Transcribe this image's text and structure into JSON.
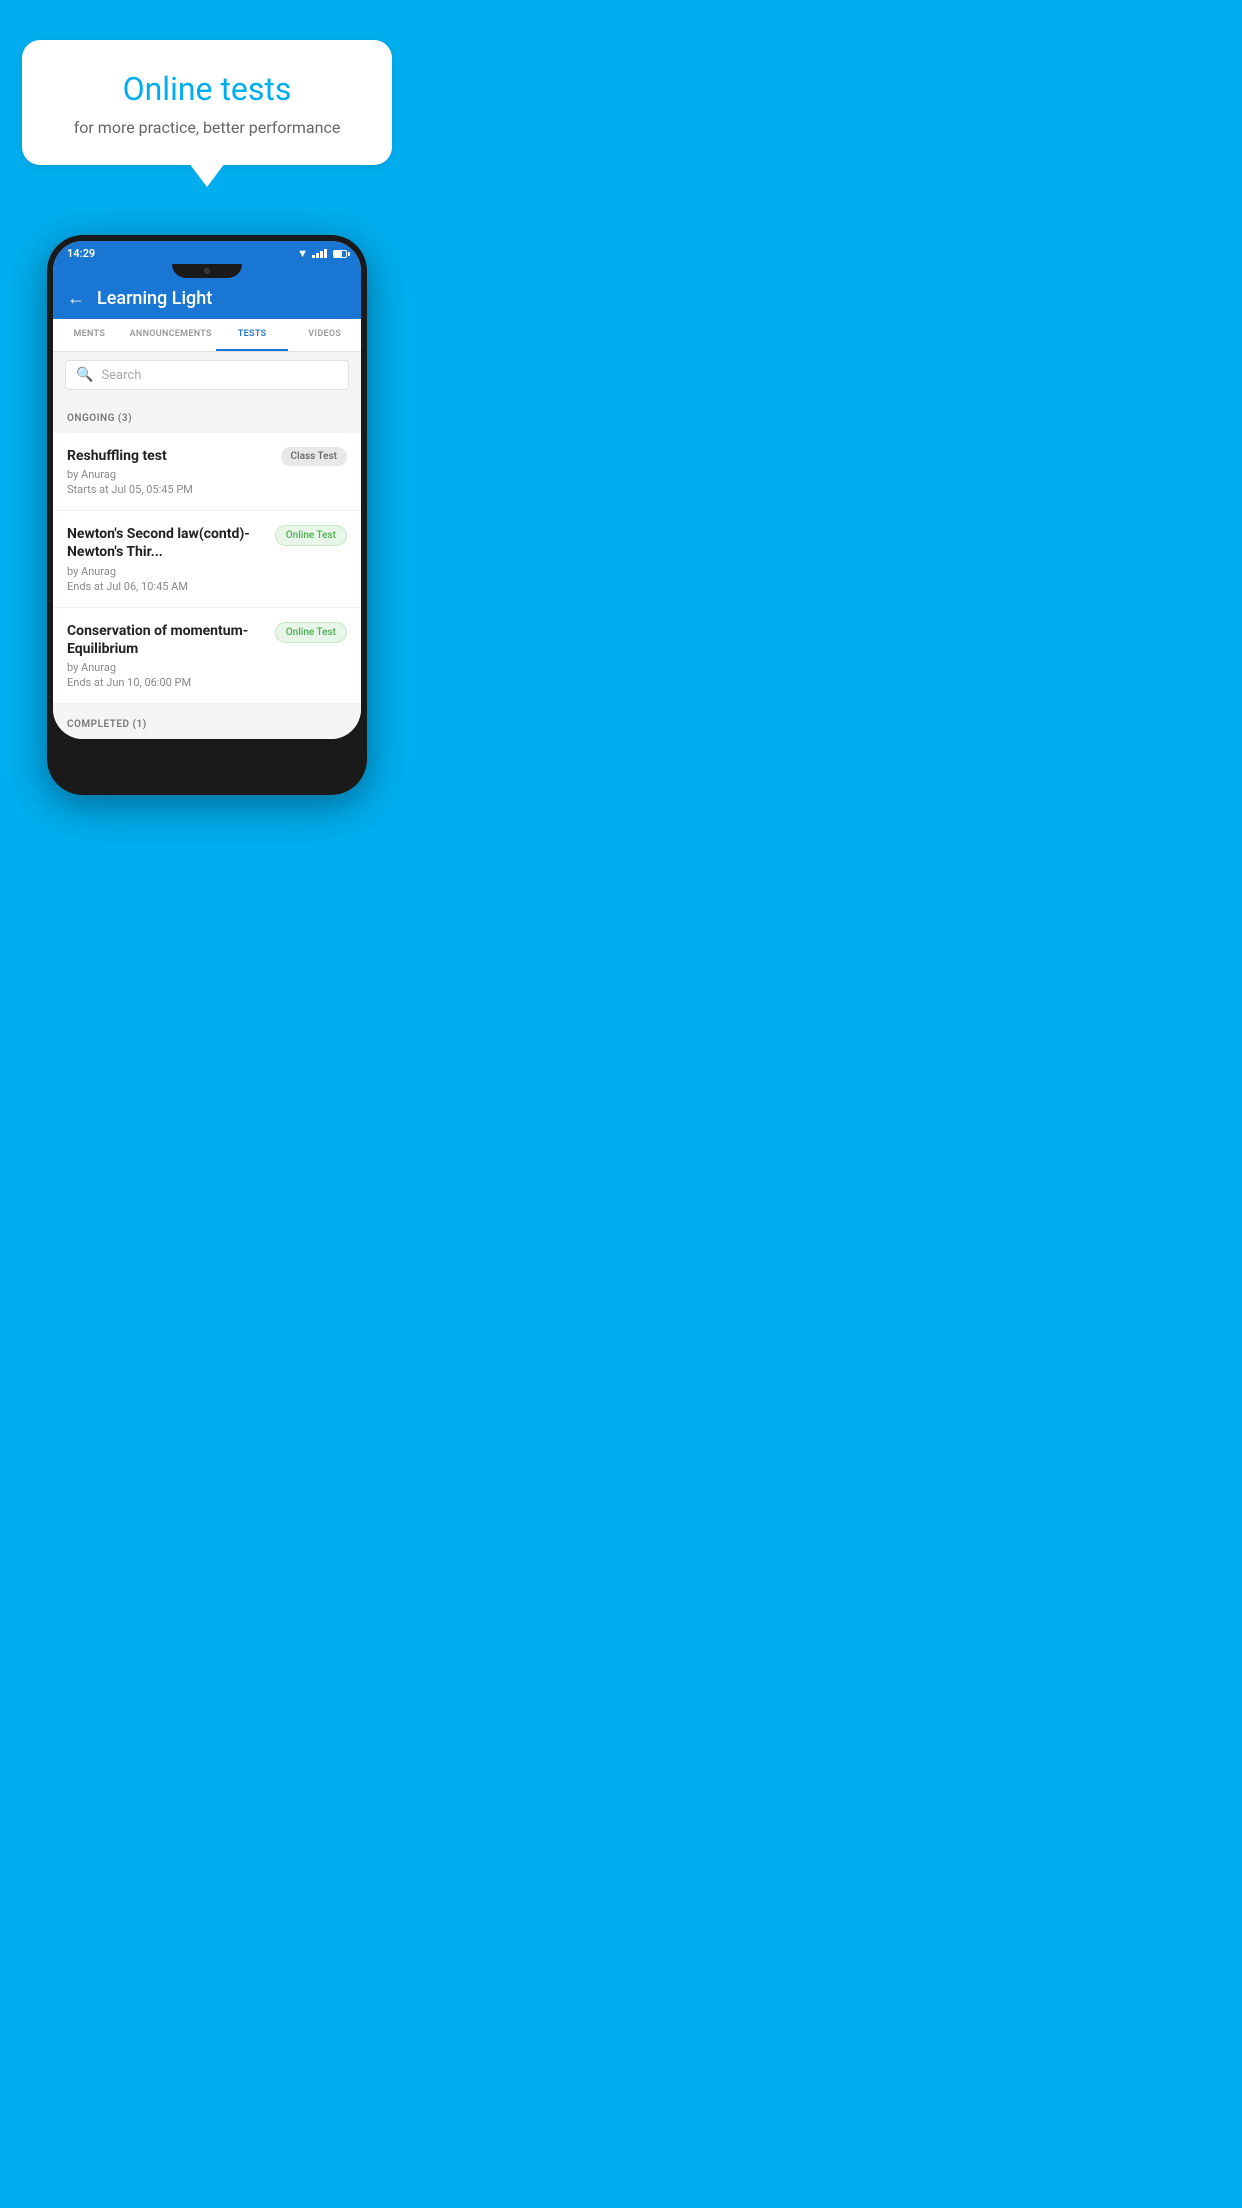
{
  "promo": {
    "bubble_title": "Online tests",
    "bubble_subtitle": "for more practice, better performance"
  },
  "phone": {
    "status": {
      "time": "14:29"
    },
    "app": {
      "title": "Learning Light"
    },
    "tabs": [
      {
        "label": "MENTS",
        "active": false
      },
      {
        "label": "ANNOUNCEMENTS",
        "active": false
      },
      {
        "label": "TESTS",
        "active": true
      },
      {
        "label": "VIDEOS",
        "active": false
      }
    ],
    "search": {
      "placeholder": "Search"
    },
    "ongoing": {
      "section_label": "ONGOING (3)",
      "tests": [
        {
          "name": "Reshuffling test",
          "author": "by Anurag",
          "time": "Starts at  Jul 05, 05:45 PM",
          "badge": "Class Test",
          "badge_type": "class"
        },
        {
          "name": "Newton's Second law(contd)-Newton's Thir...",
          "author": "by Anurag",
          "time": "Ends at  Jul 06, 10:45 AM",
          "badge": "Online Test",
          "badge_type": "online"
        },
        {
          "name": "Conservation of momentum-Equilibrium",
          "author": "by Anurag",
          "time": "Ends at  Jun 10, 06:00 PM",
          "badge": "Online Test",
          "badge_type": "online"
        }
      ]
    },
    "completed": {
      "section_label": "COMPLETED (1)"
    }
  }
}
